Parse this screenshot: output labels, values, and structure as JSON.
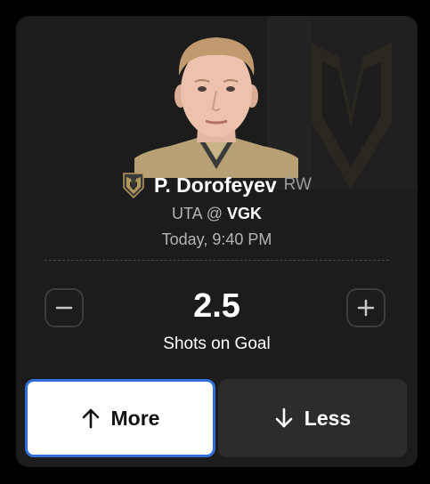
{
  "player": {
    "name": "P. Dorofeyev",
    "position": "RW",
    "away_team": "UTA",
    "separator": "@",
    "home_team": "VGK",
    "game_time": "Today, 9:40 PM",
    "team_logo_icon": "golden-knights-helmet-logo",
    "headshot": "player-headshot"
  },
  "projection": {
    "line": "2.5",
    "stat": "Shots on Goal",
    "decrease_icon": "minus-icon",
    "increase_icon": "plus-icon"
  },
  "picks": {
    "more_label": "More",
    "more_icon": "arrow-up-icon",
    "less_label": "Less",
    "less_icon": "arrow-down-icon"
  },
  "colors": {
    "card_background": "#1c1c1c",
    "selected_border": "#2f6fd6",
    "team_gold": "#b4975a"
  }
}
